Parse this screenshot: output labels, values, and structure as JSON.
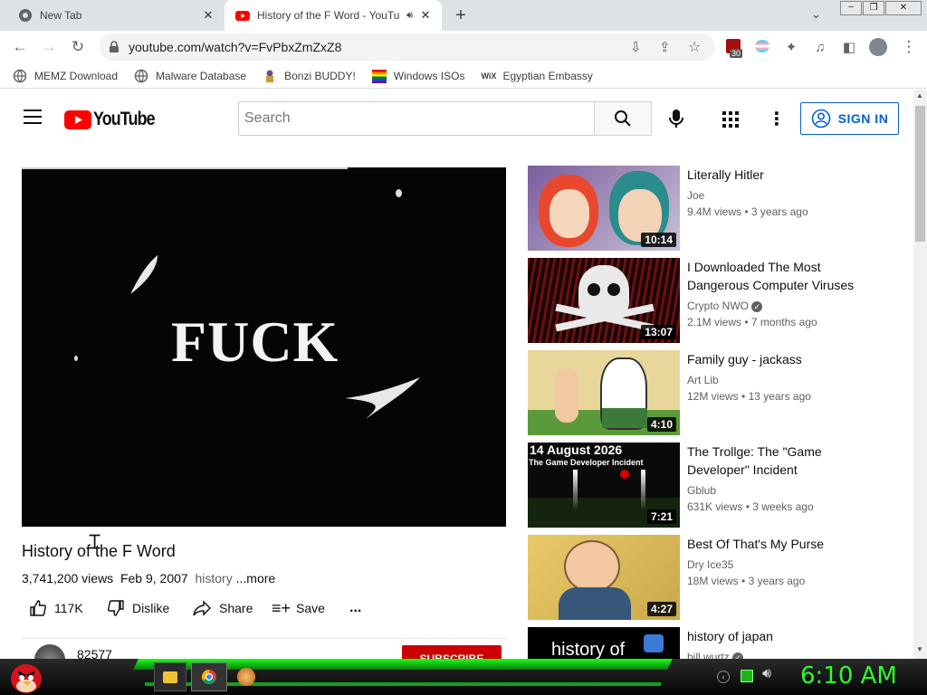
{
  "browser": {
    "tabs": [
      {
        "title": "New Tab",
        "icon": "chrome-icon",
        "active": false
      },
      {
        "title": "History of the F Word - YouTu",
        "icon": "youtube-icon",
        "active": true
      }
    ],
    "url": "youtube.com/watch?v=FvPbxZmZxZ8",
    "extension_badge": "30",
    "bookmarks": [
      {
        "label": "MEMZ Download",
        "icon": "globe-icon"
      },
      {
        "label": "Malware Database",
        "icon": "globe-icon"
      },
      {
        "label": "Bonzi BUDDY!",
        "icon": "bonzi-icon"
      },
      {
        "label": "Windows ISOs",
        "icon": "windows-flag-icon"
      },
      {
        "label": "Egyptian Embassy",
        "icon": "wix-icon"
      }
    ]
  },
  "youtube": {
    "logo_text": "YouTube",
    "search_placeholder": "Search",
    "sign_in": "SIGN IN",
    "video": {
      "frame_text": "FUCK",
      "title": "History of the F Word",
      "views": "3,741,200 views",
      "date": "Feb 9, 2007",
      "tag": "history",
      "more": "...more",
      "likes": "117K",
      "dislike": "Dislike",
      "share": "Share",
      "save": "Save",
      "more_actions": "...",
      "channel_subs": "82577",
      "subscribe": "SUBSCRIBE"
    },
    "recommendations": [
      {
        "title": "Literally Hitler",
        "channel": "Joe",
        "verified": false,
        "views": "9.4M views",
        "age": "3 years ago",
        "duration": "10:14"
      },
      {
        "title": "I Downloaded The Most Dangerous Computer Viruses",
        "channel": "Crypto NWO",
        "verified": true,
        "views": "2.1M views",
        "age": "7 months ago",
        "duration": "13:07"
      },
      {
        "title": "Family guy - jackass",
        "channel": "Art Lib",
        "verified": false,
        "views": "12M views",
        "age": "13 years ago",
        "duration": "4:10"
      },
      {
        "title": "The Trollge: The \"Game Developer\" Incident",
        "channel": "Gblub",
        "verified": false,
        "views": "631K views",
        "age": "3 weeks ago",
        "duration": "7:21",
        "thumb_line1": "14 August 2026",
        "thumb_line2": "The Game Developer Incident"
      },
      {
        "title": "Best Of That's My Purse",
        "channel": "Dry Ice35",
        "verified": false,
        "views": "18M views",
        "age": "3 years ago",
        "duration": "4:27"
      },
      {
        "title": "history of japan",
        "channel": "bill wurtz",
        "verified": true,
        "views": "",
        "age": "",
        "duration": "",
        "thumb_line1": "history of"
      }
    ]
  },
  "taskbar": {
    "clock": "6:10 AM"
  },
  "colors": {
    "youtube_red": "#ff0000",
    "link_blue": "#065fd4",
    "clock_green": "#2bff2b",
    "subscribe_red": "#cc0000"
  }
}
